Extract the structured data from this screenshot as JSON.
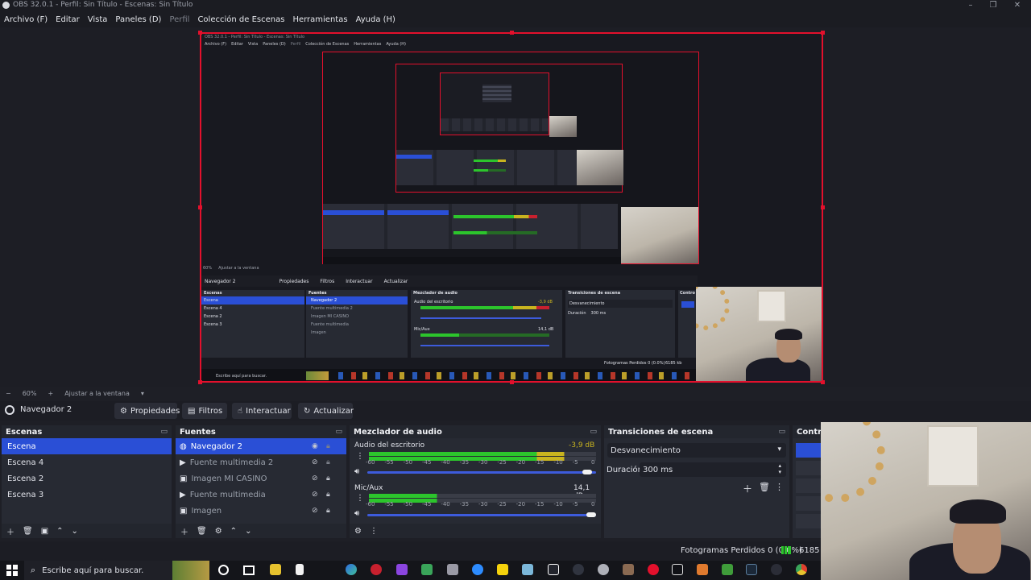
{
  "window": {
    "title": "OBS 32.0.1 - Perfil: Sin Título - Escenas: Sin Título"
  },
  "menu": [
    {
      "label": "Archivo (F)"
    },
    {
      "label": "Editar"
    },
    {
      "label": "Vista"
    },
    {
      "label": "Paneles (D)"
    },
    {
      "label": "Perfil"
    },
    {
      "label": "Colección de Escenas"
    },
    {
      "label": "Herramientas"
    },
    {
      "label": "Ayuda (H)"
    }
  ],
  "zoom": {
    "minus": "−",
    "value": "60%",
    "plus": "+",
    "fit_label": "Ajustar a la ventana"
  },
  "source_toolbar": {
    "source_name": "Navegador 2",
    "properties": "Propiedades",
    "filters": "Filtros",
    "interact": "Interactuar",
    "refresh": "Actualizar"
  },
  "scenes": {
    "title": "Escenas",
    "items": [
      {
        "label": "Escena",
        "selected": true
      },
      {
        "label": "Escena 4"
      },
      {
        "label": "Escena 2"
      },
      {
        "label": "Escena 3"
      }
    ]
  },
  "sources": {
    "title": "Fuentes",
    "items": [
      {
        "label": "Navegador 2",
        "selected": true,
        "icon": "globe-icon"
      },
      {
        "label": "Fuente multimedia 2",
        "icon": "play-icon"
      },
      {
        "label": "Imagen MI CASINO",
        "icon": "image-icon"
      },
      {
        "label": "Fuente multimedia",
        "icon": "play-icon"
      },
      {
        "label": "Imagen",
        "icon": "image-icon"
      }
    ]
  },
  "audio_mixer": {
    "title": "Mezclador de audio",
    "channels": [
      {
        "name": "Audio del escritorio",
        "db": "-3,9 dB",
        "level_fraction": 0.86,
        "volume_fraction": 0.98
      },
      {
        "name": "Mic/Aux",
        "db": "14,1 dB",
        "level_fraction": 0.3,
        "volume_fraction": 1.0
      }
    ],
    "scale": [
      "-60",
      "-55",
      "-50",
      "-45",
      "-40",
      "-35",
      "-30",
      "-25",
      "-20",
      "-15",
      "-10",
      "-5",
      "0"
    ]
  },
  "transitions": {
    "title": "Transiciones de escena",
    "selected": "Desvanecimiento",
    "duration_label": "Duración",
    "duration_value": "300 ms"
  },
  "controls": {
    "title": "Control"
  },
  "status": {
    "dropped_frames": "Fotogramas Perdidos 0 (0.0%)",
    "bitrate": "6185 kb"
  },
  "taskbar": {
    "search_placeholder": "Escribe aquí para buscar."
  },
  "nested_preview": {
    "title": "OBS 32.0.1 - Perfil: Sin Título - Escenas: Sin Título",
    "menu": [
      "Archivo (F)",
      "Editar",
      "Vista",
      "Paneles (D)",
      "Perfil",
      "Colección de Escenas",
      "Herramientas",
      "Ayuda (H)"
    ],
    "source_name": "Navegador 2",
    "buttons": [
      "Propiedades",
      "Filtros",
      "Interactuar",
      "Actualizar"
    ],
    "scenes_title": "Escenas",
    "scenes": [
      "Escena",
      "Escena 4",
      "Escena 2",
      "Escena 3"
    ],
    "sources_title": "Fuentes",
    "sources": [
      "Navegador 2",
      "Fuente multimedia 2",
      "Imagen MI CASINO",
      "Fuente multimedia",
      "Imagen"
    ],
    "mixer_title": "Mezclador de audio",
    "mixer_channels": [
      "Audio del escritorio",
      "Mic/Aux"
    ],
    "mixer_db": [
      "-3,9 dB",
      "14,1 dB"
    ],
    "transitions_title": "Transiciones de escena",
    "transition": "Desvanecimiento",
    "duration_label": "Duración",
    "duration_value": "300 ms",
    "controls_title": "Contro",
    "zoom": "60%",
    "fit_label": "Ajustar a la ventana",
    "status": "Fotogramas Perdidos 0 (0.0%)",
    "bitrate": "6185 kb",
    "search_placeholder": "Escribe aquí para buscar."
  },
  "colors": {
    "accent": "#2a4fd6",
    "selection_border": "#e3102c",
    "meter_green": "#2cc52c",
    "meter_yellow": "#c9b41f",
    "meter_red": "#c8202e"
  }
}
